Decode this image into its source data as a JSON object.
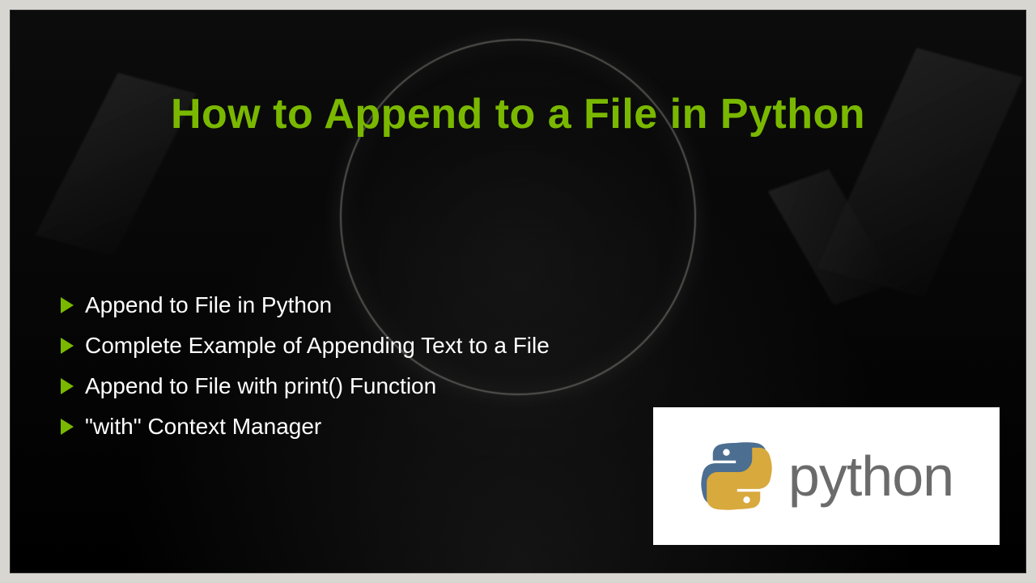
{
  "title": "How to Append to a File in Python",
  "bullets": [
    "Append to File in Python",
    "Complete Example of Appending Text to a File",
    "Append to File with print() Function",
    "\"with\" Context Manager"
  ],
  "logo": {
    "wordmark": "python"
  },
  "colors": {
    "accent": "#7ab800",
    "text": "#ffffff",
    "logo_blue": "#4b6e91",
    "logo_yellow": "#d8a93d"
  }
}
